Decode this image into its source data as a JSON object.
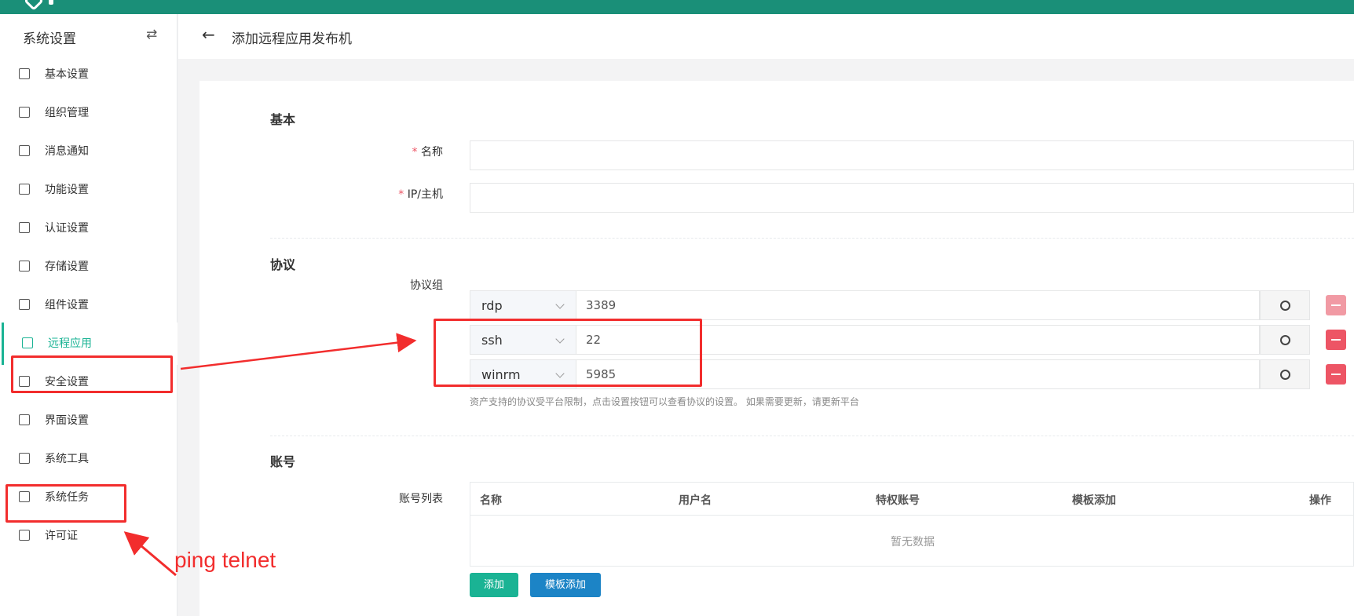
{
  "sidebar": {
    "title": "系统设置",
    "swap_icon": "swap-icon",
    "items": [
      {
        "label": "基本设置",
        "icon": "grid-icon"
      },
      {
        "label": "组织管理",
        "icon": "org-icon"
      },
      {
        "label": "消息通知",
        "icon": "message-icon"
      },
      {
        "label": "功能设置",
        "icon": "cube-icon"
      },
      {
        "label": "认证设置",
        "icon": "id-card-icon"
      },
      {
        "label": "存储设置",
        "icon": "storage-icon"
      },
      {
        "label": "组件设置",
        "icon": "monitor-icon"
      },
      {
        "label": "远程应用",
        "icon": "apps-icon",
        "active": true
      },
      {
        "label": "安全设置",
        "icon": "shield-icon"
      },
      {
        "label": "界面设置",
        "icon": "layout-icon"
      },
      {
        "label": "系统工具",
        "icon": "toolbox-icon"
      },
      {
        "label": "系统任务",
        "icon": "task-icon"
      },
      {
        "label": "许可证",
        "icon": "license-icon"
      }
    ]
  },
  "header": {
    "title": "添加远程应用发布机"
  },
  "form": {
    "basic": {
      "section_title": "基本",
      "name_label": "名称",
      "host_label": "IP/主机",
      "required_mark": "*"
    },
    "protocol": {
      "section_title": "协议",
      "group_label": "协议组",
      "rows": [
        {
          "protocol": "rdp",
          "port": "3389",
          "remove_disabled": true
        },
        {
          "protocol": "ssh",
          "port": "22",
          "remove_disabled": false
        },
        {
          "protocol": "winrm",
          "port": "5985",
          "remove_disabled": false
        }
      ],
      "hint": "资产支持的协议受平台限制，点击设置按钮可以查看协议的设置。 如果需要更新，请更新平台"
    },
    "account": {
      "section_title": "账号",
      "list_label": "账号列表",
      "columns": [
        "名称",
        "用户名",
        "特权账号",
        "模板添加",
        "操作"
      ],
      "empty_text": "暂无数据",
      "add_button": "添加",
      "template_add_button": "模板添加"
    }
  },
  "annotations": {
    "note_text": "ping telnet",
    "color": "#f22d2d"
  },
  "colors": {
    "topbar": "#1a8f78",
    "accent": "#1ab394",
    "danger": "#ed5565",
    "primary_blue": "#1c84c6"
  }
}
